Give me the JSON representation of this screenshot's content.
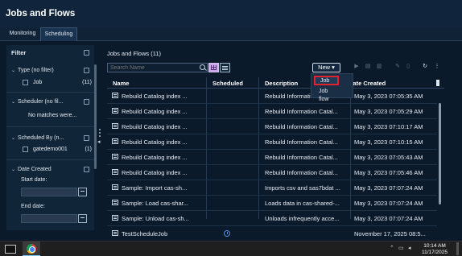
{
  "app": {
    "title": "Jobs and Flows"
  },
  "tabs": [
    {
      "label": "Monitoring"
    },
    {
      "label": "Scheduling"
    }
  ],
  "filter": {
    "title": "Filter",
    "type": {
      "label": "Type (no filter)",
      "item": "Job",
      "count": "(11)"
    },
    "scheduler": {
      "label": "Scheduler (no fil...",
      "message": "No matches were..."
    },
    "scheduled_by": {
      "label": "Scheduled By (n...",
      "item": "gatedemo001",
      "count": "(1)"
    },
    "date_created": {
      "label": "Date Created",
      "start": "Start date:",
      "end": "End date:"
    }
  },
  "main": {
    "title": "Jobs and Flows (11)",
    "search_placeholder": "Search Name",
    "new_label": "New ▾",
    "new_menu": [
      "Job",
      "Job flow"
    ],
    "columns": {
      "name": "Name",
      "scheduled": "Scheduled",
      "description": "Description",
      "date_created": "Date Created"
    },
    "rows": [
      {
        "name": "Rebuild Catalog index ...",
        "scheduled": false,
        "description": "Rebuild Information Catal...",
        "date": "May 3, 2023 07:05:35 AM"
      },
      {
        "name": "Rebuild Catalog index ...",
        "scheduled": false,
        "description": "Rebuild Information Catal...",
        "date": "May 3, 2023 07:05:29 AM"
      },
      {
        "name": "Rebuild Catalog index ...",
        "scheduled": false,
        "description": "Rebuild Information Catal...",
        "date": "May 3, 2023 07:10:17 AM"
      },
      {
        "name": "Rebuild Catalog index ...",
        "scheduled": false,
        "description": "Rebuild Information Catal...",
        "date": "May 3, 2023 07:10:15 AM"
      },
      {
        "name": "Rebuild Catalog index ...",
        "scheduled": false,
        "description": "Rebuild Information Catal...",
        "date": "May 3, 2023 07:05:43 AM"
      },
      {
        "name": "Rebuild Catalog index ...",
        "scheduled": false,
        "description": "Rebuild Information Catal...",
        "date": "May 3, 2023 07:05:46 AM"
      },
      {
        "name": "Sample: Import cas-sh...",
        "scheduled": false,
        "description": "Imports csv and sas7bdat ...",
        "date": "May 3, 2023 07:07:24 AM"
      },
      {
        "name": "Sample: Load cas-shar...",
        "scheduled": false,
        "description": "Loads data in cas-shared-...",
        "date": "May 3, 2023 07:07:24 AM"
      },
      {
        "name": "Sample: Unload cas-sh...",
        "scheduled": false,
        "description": "Unloads infrequently acce...",
        "date": "May 3, 2023 07:07:24 AM"
      },
      {
        "name": "TestScheduleJob",
        "scheduled": true,
        "description": "",
        "date": "November 17, 2025 08:5..."
      }
    ]
  },
  "taskbar": {
    "time": "10:14 AM",
    "date": "11/17/2025"
  },
  "colors": {
    "background": "#0b1a2b",
    "accent": "#c7a7e6",
    "highlight": "#e0242c",
    "schedule_icon": "#5b8fe0"
  }
}
